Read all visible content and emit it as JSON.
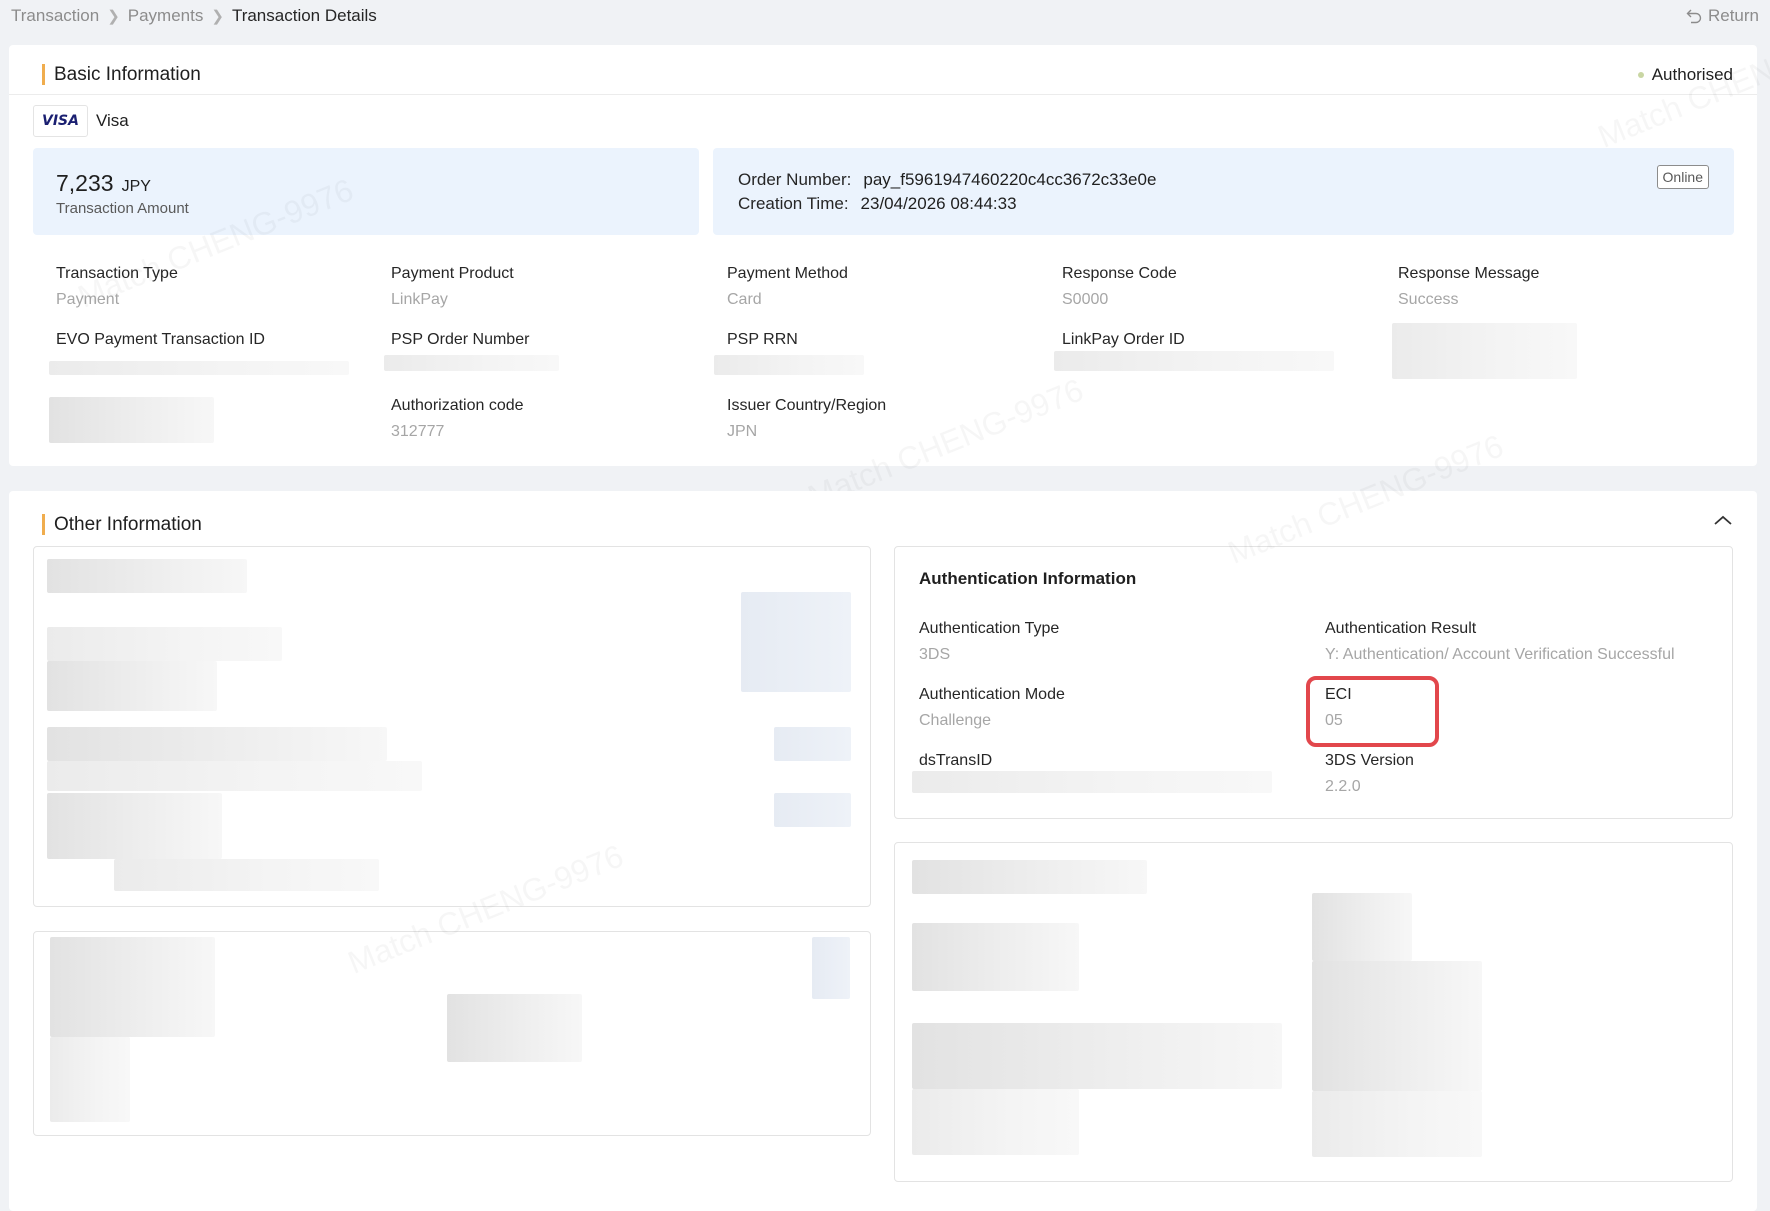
{
  "breadcrumb": {
    "items": [
      "Transaction",
      "Payments",
      "Transaction Details"
    ],
    "return_label": "Return"
  },
  "basic": {
    "title": "Basic Information",
    "status": "Authorised",
    "card_brand_logo": "VISA",
    "card_brand": "Visa",
    "amount": "7,233",
    "currency": "JPY",
    "amount_label": "Transaction Amount",
    "order_number_label": "Order Number:",
    "order_number": "pay_f5961947460220c4cc3672c33e0e",
    "creation_time_label": "Creation Time:",
    "creation_time": "23/04/2026 08:44:33",
    "channel_badge": "Online",
    "fields": [
      {
        "label": "Transaction Type",
        "value": "Payment"
      },
      {
        "label": "Payment Product",
        "value": "LinkPay"
      },
      {
        "label": "Payment Method",
        "value": "Card"
      },
      {
        "label": "Response Code",
        "value": "S0000"
      },
      {
        "label": "Response Message",
        "value": "Success"
      },
      {
        "label": "EVO Payment Transaction ID",
        "value": ""
      },
      {
        "label": "PSP Order Number",
        "value": ""
      },
      {
        "label": "PSP RRN",
        "value": ""
      },
      {
        "label": "LinkPay Order ID",
        "value": ""
      },
      {
        "label": "Authorization code",
        "value": "312777"
      },
      {
        "label": "Issuer Country/Region",
        "value": "JPN"
      }
    ]
  },
  "other": {
    "title": "Other Information",
    "auth": {
      "title": "Authentication Information",
      "fields": [
        {
          "label": "Authentication Type",
          "value": "3DS"
        },
        {
          "label": "Authentication Result",
          "value": "Y: Authentication/ Account Verification Successful"
        },
        {
          "label": "Authentication Mode",
          "value": "Challenge"
        },
        {
          "label": "ECI",
          "value": "05"
        },
        {
          "label": "dsTransID",
          "value": ""
        },
        {
          "label": "3DS Version",
          "value": "2.2.0"
        }
      ]
    }
  },
  "watermark_text": "Match CHENG-9976",
  "icons": {
    "return": "return-arrow-icon",
    "breadcrumb_sep": "chevron-right-icon",
    "collapse": "chevron-up-icon",
    "status": "status-dot-icon"
  },
  "colors": {
    "accent_bar": "#f0ad4e",
    "panel_bg": "#ebf3fd",
    "highlight": "#e2474c"
  }
}
